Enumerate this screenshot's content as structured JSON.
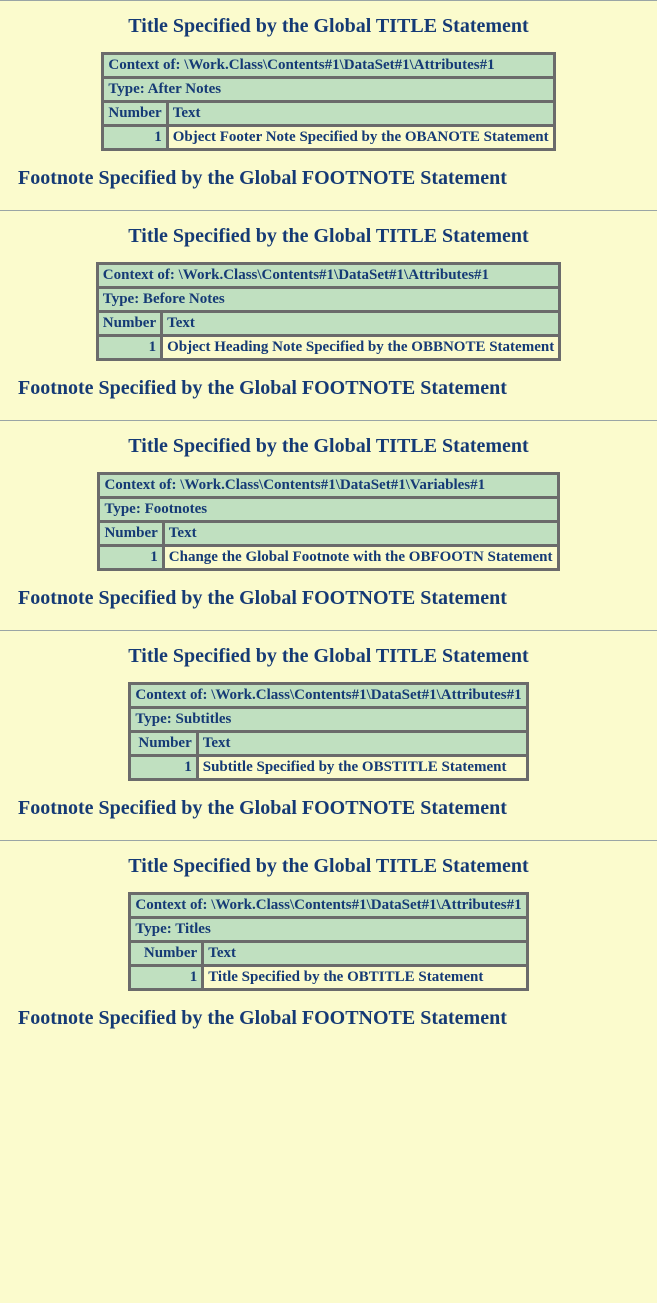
{
  "common": {
    "title": "Title Specified by the Global TITLE Statement",
    "footnote": "Footnote Specified by the Global FOOTNOTE Statement",
    "col_number": "Number",
    "col_text": "Text"
  },
  "blocks": [
    {
      "context": "Context of: \\Work.Class\\Contents#1\\DataSet#1\\Attributes#1",
      "type": "Type: After Notes",
      "rows": [
        {
          "num": "1",
          "text": "Object Footer Note Specified by the OBANOTE Statement"
        }
      ]
    },
    {
      "context": "Context of: \\Work.Class\\Contents#1\\DataSet#1\\Attributes#1",
      "type": "Type: Before Notes",
      "rows": [
        {
          "num": "1",
          "text": "Object Heading Note Specified by the OBBNOTE Statement"
        }
      ]
    },
    {
      "context": "Context of: \\Work.Class\\Contents#1\\DataSet#1\\Variables#1",
      "type": "Type: Footnotes",
      "rows": [
        {
          "num": "1",
          "text": "Change the Global Footnote with the OBFOOTN Statement"
        }
      ]
    },
    {
      "context": "Context of: \\Work.Class\\Contents#1\\DataSet#1\\Attributes#1",
      "type": "Type: Subtitles",
      "rows": [
        {
          "num": "1",
          "text": "Subtitle Specified by the OBSTITLE Statement"
        }
      ]
    },
    {
      "context": "Context of: \\Work.Class\\Contents#1\\DataSet#1\\Attributes#1",
      "type": "Type: Titles",
      "rows": [
        {
          "num": "1",
          "text": "Title Specified by the OBTITLE Statement"
        }
      ]
    }
  ]
}
